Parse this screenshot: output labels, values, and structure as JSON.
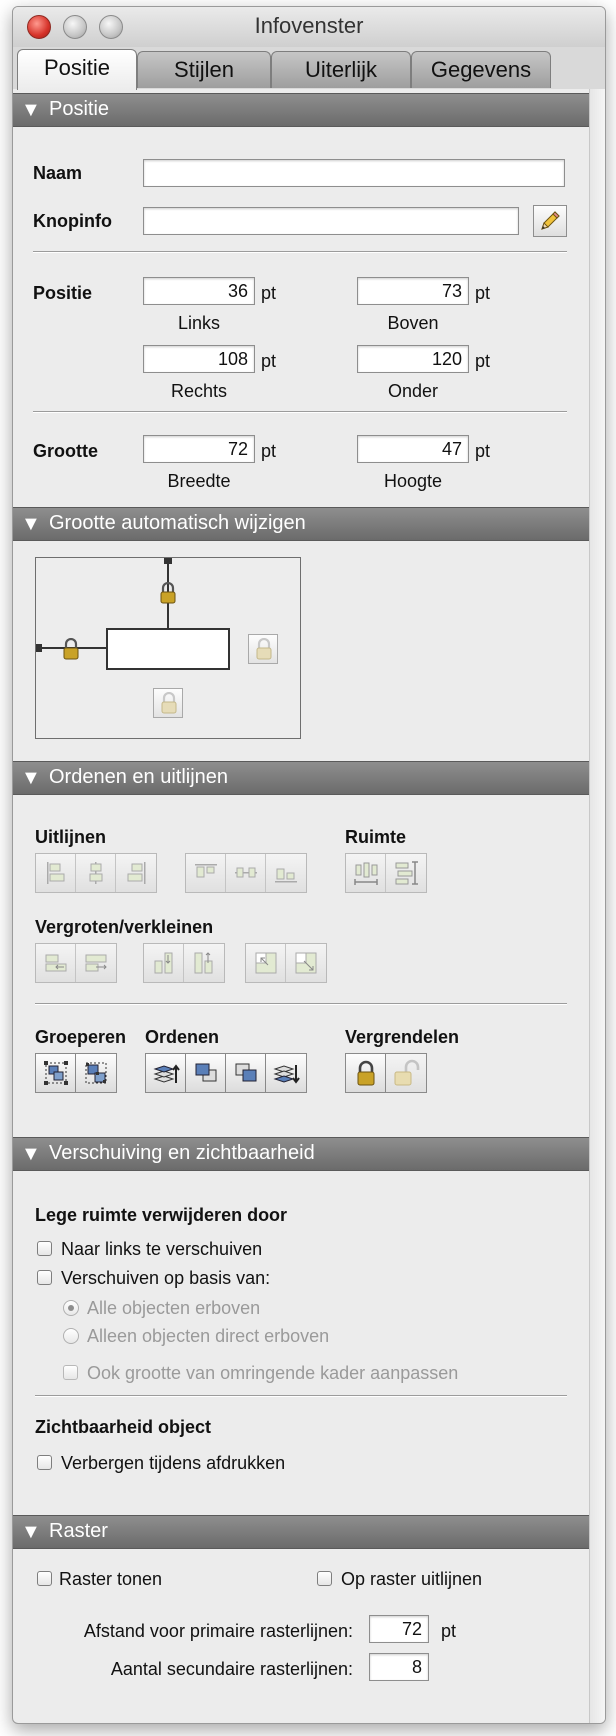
{
  "window": {
    "title": "Infovenster"
  },
  "tabs": [
    {
      "label": "Positie",
      "active": true
    },
    {
      "label": "Stijlen",
      "active": false
    },
    {
      "label": "Uiterlijk",
      "active": false
    },
    {
      "label": "Gegevens",
      "active": false
    }
  ],
  "positie": {
    "header": "Positie",
    "naam_label": "Naam",
    "naam_value": "",
    "knopinfo_label": "Knopinfo",
    "knopinfo_value": "",
    "positie_label": "Positie",
    "links_value": "36",
    "links_label": "Links",
    "boven_value": "73",
    "boven_label": "Boven",
    "rechts_value": "108",
    "rechts_label": "Rechts",
    "onder_value": "120",
    "onder_label": "Onder",
    "grootte_label": "Grootte",
    "breedte_value": "72",
    "breedte_label": "Breedte",
    "hoogte_value": "47",
    "hoogte_label": "Hoogte",
    "unit": "pt"
  },
  "autosize": {
    "header": "Grootte automatisch wijzigen"
  },
  "arrange": {
    "header": "Ordenen en uitlijnen",
    "uitlijnen_label": "Uitlijnen",
    "ruimte_label": "Ruimte",
    "vergroten_label": "Vergroten/verkleinen",
    "groeperen_label": "Groeperen",
    "ordenen_label": "Ordenen",
    "vergrendelen_label": "Vergrendelen"
  },
  "sliding": {
    "header": "Verschuiving en zichtbaarheid",
    "lege_ruimte_label": "Lege ruimte verwijderen door",
    "naar_links_label": "Naar links te verschuiven",
    "verschuiven_label": "Verschuiven op basis van:",
    "alle_objecten_label": "Alle objecten erboven",
    "alleen_objecten_label": "Alleen objecten direct erboven",
    "ook_grootte_label": "Ook grootte van omringende kader aanpassen",
    "zichtbaarheid_label": "Zichtbaarheid object",
    "verbergen_label": "Verbergen tijdens afdrukken"
  },
  "raster": {
    "header": "Raster",
    "tonen_label": "Raster tonen",
    "uitlijnen_label": "Op raster uitlijnen",
    "afstand_label": "Afstand voor primaire rasterlijnen:",
    "afstand_value": "72",
    "afstand_unit": "pt",
    "aantal_label": "Aantal secundaire rasterlijnen:",
    "aantal_value": "8"
  }
}
